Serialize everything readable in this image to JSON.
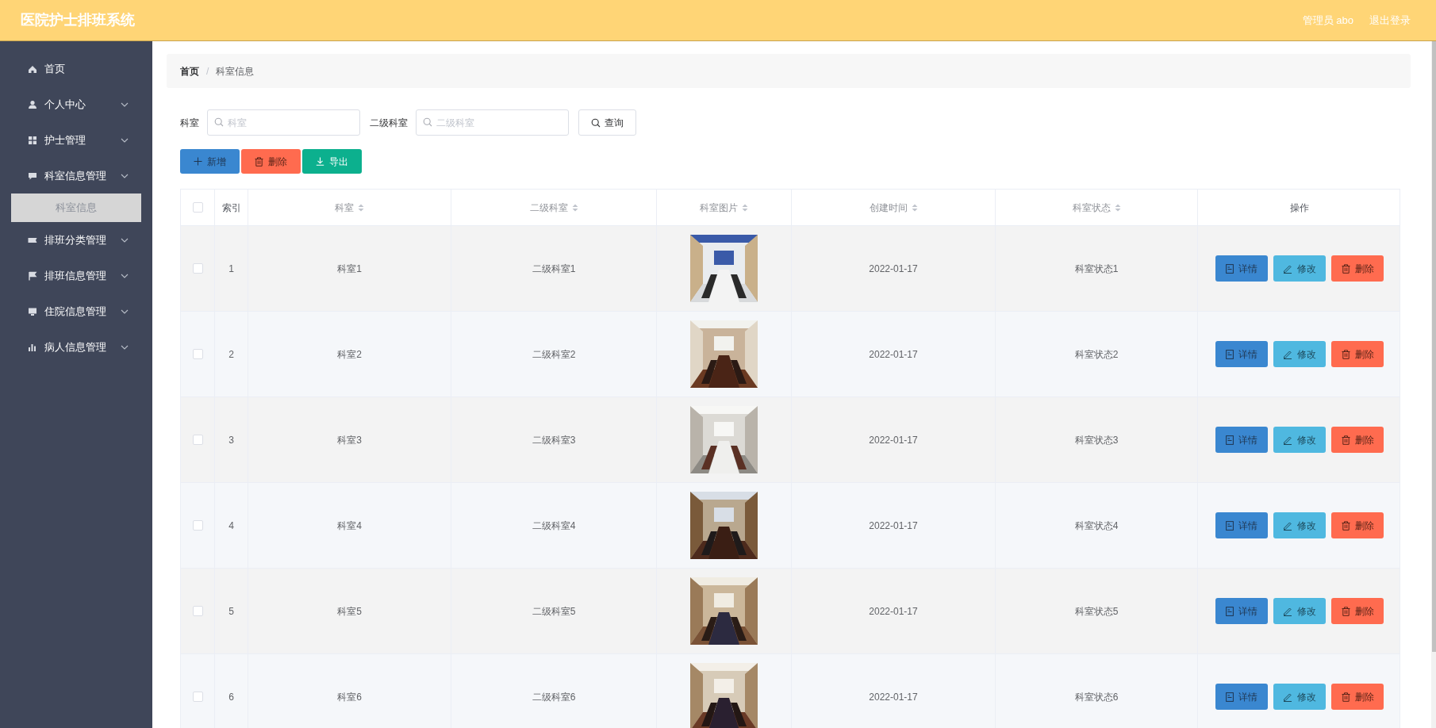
{
  "header": {
    "title": "医院护士排班系统",
    "user": "管理员 abo",
    "logout": "退出登录"
  },
  "sidebar": {
    "items": [
      {
        "label": "首页",
        "expandable": false
      },
      {
        "label": "个人中心",
        "expandable": true
      },
      {
        "label": "护士管理",
        "expandable": true
      },
      {
        "label": "科室信息管理",
        "expandable": true,
        "children": [
          {
            "label": "科室信息",
            "selected": true
          }
        ]
      },
      {
        "label": "排班分类管理",
        "expandable": true
      },
      {
        "label": "排班信息管理",
        "expandable": true
      },
      {
        "label": "住院信息管理",
        "expandable": true
      },
      {
        "label": "病人信息管理",
        "expandable": true
      }
    ]
  },
  "breadcrumb": {
    "separator": "/",
    "items": [
      {
        "label": "首页",
        "current": false
      },
      {
        "label": "科室信息",
        "current": true
      }
    ]
  },
  "search": {
    "fields": [
      {
        "label": "科室",
        "placeholder": "科室"
      },
      {
        "label": "二级科室",
        "placeholder": "二级科室"
      }
    ],
    "button": "查询"
  },
  "actions": [
    {
      "label": "新增",
      "kind": "add"
    },
    {
      "label": "删除",
      "kind": "delete"
    },
    {
      "label": "导出",
      "kind": "export"
    }
  ],
  "table": {
    "select_all": false,
    "columns": [
      {
        "label": "索引",
        "sortable": false
      },
      {
        "label": "科室",
        "sortable": true
      },
      {
        "label": "二级科室",
        "sortable": true
      },
      {
        "label": "科室图片",
        "sortable": true
      },
      {
        "label": "创建时间",
        "sortable": true
      },
      {
        "label": "科室状态",
        "sortable": true
      },
      {
        "label": "操作",
        "sortable": false
      }
    ],
    "rows": [
      {
        "checked": false,
        "index": "1",
        "department": "科室1",
        "sub_department": "二级科室1",
        "created": "2022-01-17",
        "status": "科室状态1",
        "actions": [
          {
            "label": "详情",
            "kind": "detail"
          },
          {
            "label": "修改",
            "kind": "edit"
          },
          {
            "label": "删除",
            "kind": "delete"
          }
        ]
      },
      {
        "checked": false,
        "index": "2",
        "department": "科室2",
        "sub_department": "二级科室2",
        "created": "2022-01-17",
        "status": "科室状态2",
        "actions": [
          {
            "label": "详情",
            "kind": "detail"
          },
          {
            "label": "修改",
            "kind": "edit"
          },
          {
            "label": "删除",
            "kind": "delete"
          }
        ]
      },
      {
        "checked": false,
        "index": "3",
        "department": "科室3",
        "sub_department": "二级科室3",
        "created": "2022-01-17",
        "status": "科室状态3",
        "actions": [
          {
            "label": "详情",
            "kind": "detail"
          },
          {
            "label": "修改",
            "kind": "edit"
          },
          {
            "label": "删除",
            "kind": "delete"
          }
        ]
      },
      {
        "checked": false,
        "index": "4",
        "department": "科室4",
        "sub_department": "二级科室4",
        "created": "2022-01-17",
        "status": "科室状态4",
        "actions": [
          {
            "label": "详情",
            "kind": "detail"
          },
          {
            "label": "修改",
            "kind": "edit"
          },
          {
            "label": "删除",
            "kind": "delete"
          }
        ]
      },
      {
        "checked": false,
        "index": "5",
        "department": "科室5",
        "sub_department": "二级科室5",
        "created": "2022-01-17",
        "status": "科室状态5",
        "actions": [
          {
            "label": "详情",
            "kind": "detail"
          },
          {
            "label": "修改",
            "kind": "edit"
          },
          {
            "label": "删除",
            "kind": "delete"
          }
        ]
      },
      {
        "checked": false,
        "index": "6",
        "department": "科室6",
        "sub_department": "二级科室6",
        "created": "2022-01-17",
        "status": "科室状态6",
        "actions": [
          {
            "label": "详情",
            "kind": "detail"
          },
          {
            "label": "修改",
            "kind": "edit"
          },
          {
            "label": "删除",
            "kind": "delete"
          }
        ]
      }
    ]
  }
}
